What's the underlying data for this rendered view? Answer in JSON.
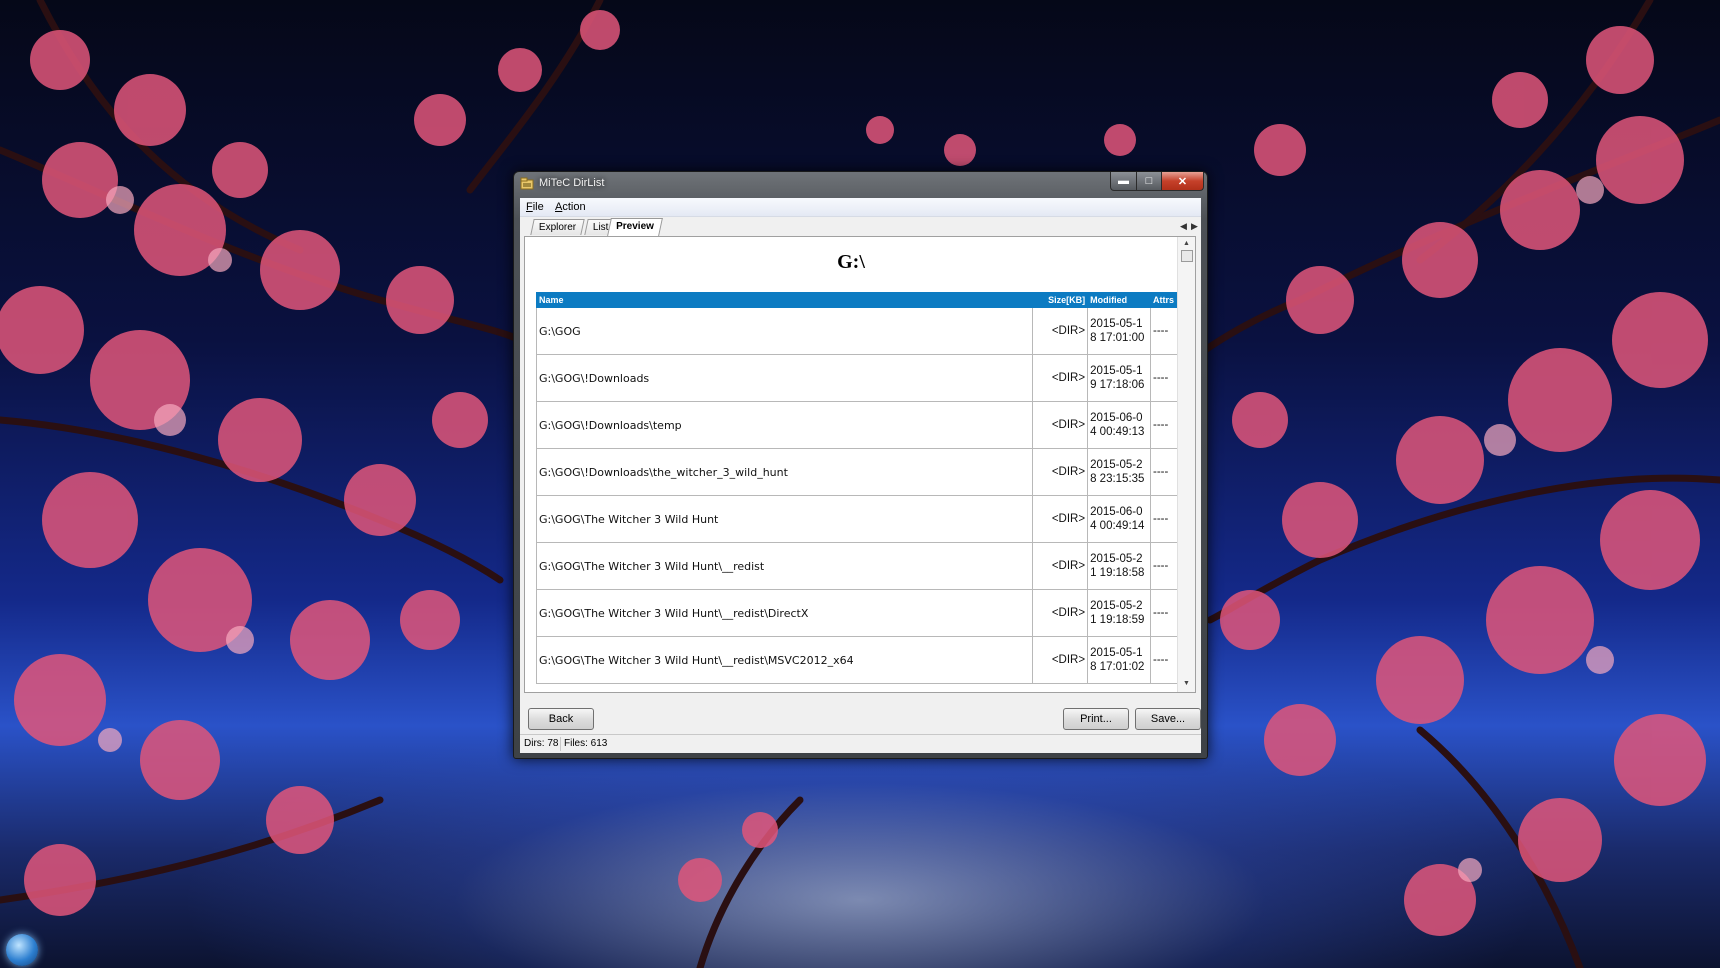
{
  "window": {
    "title": "MiTeC DirList"
  },
  "menu": {
    "file": "File",
    "file_hotkey": "F",
    "file_rest": "ile",
    "action": "Action",
    "action_hotkey": "A",
    "action_rest": "ction"
  },
  "tabs": [
    {
      "label": "Explorer",
      "active": false
    },
    {
      "label": "List",
      "active": false
    },
    {
      "label": "Preview",
      "active": true
    }
  ],
  "preview": {
    "heading": "G:\\",
    "columns": {
      "name": "Name",
      "size": "Size[KB]",
      "modified": "Modified",
      "attrs": "Attrs"
    },
    "rows": [
      {
        "name": "G:\\GOG",
        "size": "<DIR>",
        "modified": "2015-05-18 17:01:00",
        "attrs": "----"
      },
      {
        "name": "G:\\GOG\\!Downloads",
        "size": "<DIR>",
        "modified": "2015-05-19 17:18:06",
        "attrs": "----"
      },
      {
        "name": "G:\\GOG\\!Downloads\\temp",
        "size": "<DIR>",
        "modified": "2015-06-04 00:49:13",
        "attrs": "----"
      },
      {
        "name": "G:\\GOG\\!Downloads\\the_witcher_3_wild_hunt",
        "size": "<DIR>",
        "modified": "2015-05-28 23:15:35",
        "attrs": "----"
      },
      {
        "name": "G:\\GOG\\The Witcher 3 Wild Hunt",
        "size": "<DIR>",
        "modified": "2015-06-04 00:49:14",
        "attrs": "----"
      },
      {
        "name": "G:\\GOG\\The Witcher 3 Wild Hunt\\__redist",
        "size": "<DIR>",
        "modified": "2015-05-21 19:18:58",
        "attrs": "----"
      },
      {
        "name": "G:\\GOG\\The Witcher 3 Wild Hunt\\__redist\\DirectX",
        "size": "<DIR>",
        "modified": "2015-05-21 19:18:59",
        "attrs": "----"
      },
      {
        "name": "G:\\GOG\\The Witcher 3 Wild Hunt\\__redist\\MSVC2012_x64",
        "size": "<DIR>",
        "modified": "2015-05-18 17:01:02",
        "attrs": "----"
      }
    ]
  },
  "buttons": {
    "back": "Back",
    "print": "Print...",
    "save": "Save..."
  },
  "status": {
    "dirs": "Dirs: 78",
    "files": "Files: 613"
  },
  "icons": {
    "app": "app-icon",
    "minimize": "minimize-icon",
    "maximize": "maximize-icon",
    "close": "close-icon",
    "tab_left": "chevron-left-icon",
    "tab_right": "chevron-right-icon"
  },
  "colors": {
    "table_header": "#0c7bc2",
    "close_button": "#c5412a"
  }
}
